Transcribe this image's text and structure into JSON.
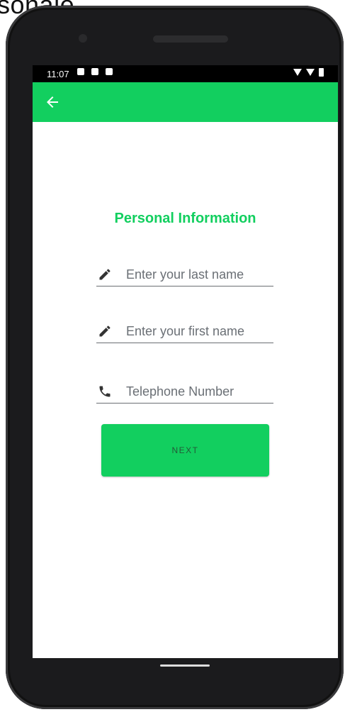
{
  "overlay_text": "sonale",
  "status_bar": {
    "time": "11:07"
  },
  "app_bar": {
    "back_icon": "arrow-left-icon",
    "color": "#12cf5f"
  },
  "form": {
    "title": "Personal Information",
    "fields": [
      {
        "icon": "pencil-icon",
        "placeholder": "Enter your last name"
      },
      {
        "icon": "pencil-icon",
        "placeholder": "Enter your first name"
      },
      {
        "icon": "phone-icon",
        "placeholder": "Telephone Number"
      }
    ],
    "next_label": "NEXT"
  }
}
